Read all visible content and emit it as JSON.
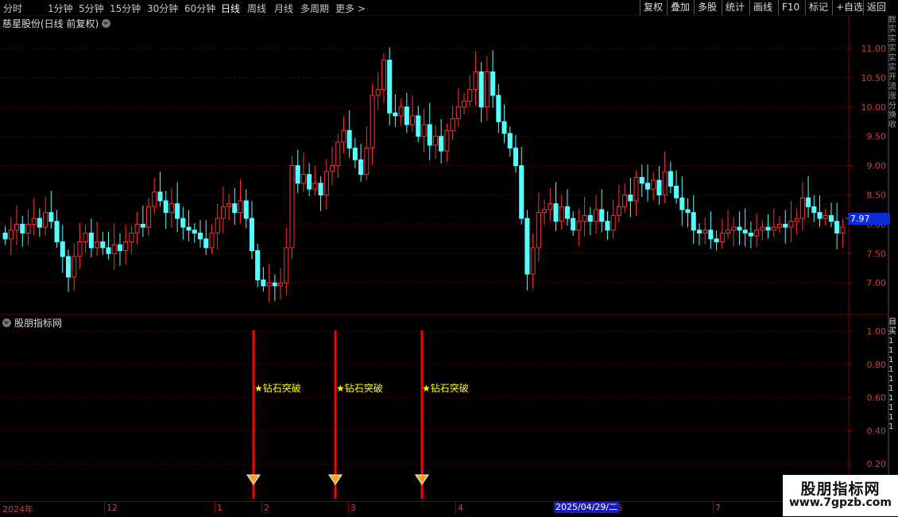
{
  "toolbar": {
    "timeframes": [
      "分时",
      "1分钟",
      "5分钟",
      "15分钟",
      "30分钟",
      "60分钟",
      "日线",
      "周线",
      "月线",
      "多周期",
      "更多 >"
    ],
    "active_timeframe": "日线",
    "right_buttons": [
      "复权",
      "叠加",
      "多股",
      "统计",
      "画线",
      "F10",
      "标记",
      "+自选",
      "返回"
    ]
  },
  "chart": {
    "title": "慈星股份(日线 前复权)",
    "price_ticks": [
      "11.00",
      "10.50",
      "10.00",
      "9.50",
      "9.00",
      "8.50",
      "8.00",
      "7.50",
      "7.00"
    ],
    "current_price": "7.97"
  },
  "indicator": {
    "title": "股朋指标网",
    "ticks": [
      "1.00",
      "0.80",
      "0.60",
      "0.40",
      "0.20"
    ],
    "signals": [
      {
        "label": "★钻石突破"
      },
      {
        "label": "★钻石突破"
      },
      {
        "label": "★钻石突破"
      }
    ]
  },
  "date_axis": {
    "labels": [
      "2024年",
      "12",
      "1",
      "2",
      "3",
      "4",
      "6",
      "7"
    ],
    "cursor_date": "2025/04/29/二"
  },
  "side_strip": [
    "数",
    "实",
    "实",
    "实",
    "实",
    "实",
    "开",
    "流",
    "涨",
    "分",
    "换",
    "收"
  ],
  "side_strip_lower": [
    "自",
    "买",
    "1",
    "1",
    "1",
    "1",
    "1",
    "1",
    "1",
    "1",
    "1",
    "1"
  ],
  "watermark": {
    "line1": "股朋指标网",
    "line2": "www.7gpzb.com"
  },
  "colors": {
    "up": "#ff3232",
    "down": "#54ffff",
    "grid": "#5a0000",
    "signal": "#ff0000",
    "signal_text": "#ffff00"
  }
}
